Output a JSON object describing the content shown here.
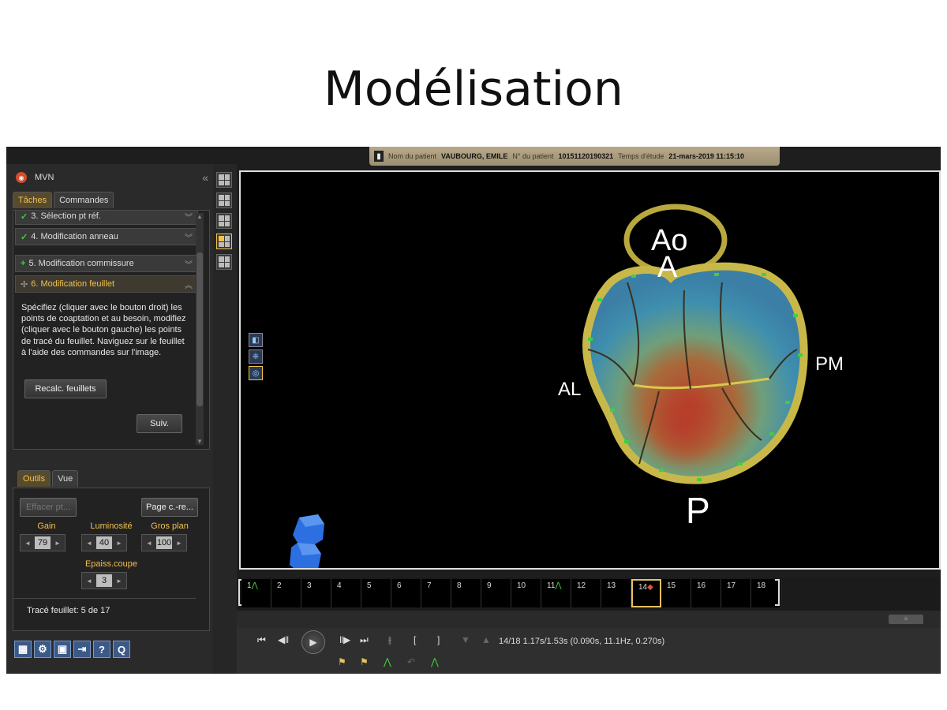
{
  "slide": {
    "title": "Modélisation"
  },
  "patient": {
    "name_label": "Nom du patient",
    "name_value": "VAUBOURG, EMILE",
    "id_label": "N° du patient",
    "id_value": "10151120190321",
    "study_label": "Temps d'étude",
    "study_value": "21-mars-2019 11:15:10"
  },
  "panel": {
    "title": "MVN",
    "collapse_icon": "«",
    "tabs": [
      "Tâches",
      "Commandes"
    ],
    "tasks": [
      {
        "label": "3. Sélection pt réf.",
        "status": "done"
      },
      {
        "label": "4. Modification anneau",
        "status": "done"
      },
      {
        "label": "5. Modification commissure",
        "status": "plus"
      },
      {
        "label": "6. Modification feuillet",
        "status": "current"
      }
    ],
    "description": "Spécifiez (cliquer avec le bouton droit) les points de coaptation et au besoin, modifiez (cliquer avec le bouton gauche) les points de tracé du feuillet. Naviguez sur le feuillet à l'aide des commandes sur l'image.",
    "recalc_button": "Recalc. feuillets",
    "next_button": "Suiv."
  },
  "tools": {
    "tabs": [
      "Outils",
      "Vue"
    ],
    "erase_button": "Effacer pt...",
    "page_button": "Page c.-re...",
    "gain_label": "Gain",
    "gain_value": "79",
    "brightness_label": "Luminosité",
    "brightness_value": "40",
    "zoom_label": "Gros plan",
    "zoom_value": "100",
    "thickness_label": "Epaiss.coupe",
    "thickness_value": "3",
    "trace_status": "Tracé feuillet: 5 de 17"
  },
  "viewer": {
    "labels": {
      "ao": "Ao",
      "a": "A",
      "pm": "PM",
      "al": "AL",
      "p": "P"
    }
  },
  "timeline": {
    "frames": [
      "1",
      "2",
      "3",
      "4",
      "5",
      "6",
      "7",
      "8",
      "9",
      "10",
      "11",
      "12",
      "13",
      "14",
      "15",
      "16",
      "17",
      "18"
    ],
    "ecg_frames": [
      1,
      11
    ],
    "selected_frame": 14,
    "status": "14/18  1.17s/1.53s (0.090s, 11.1Hz, 0.270s)"
  },
  "colors": {
    "accent": "#f2c14e",
    "annulus": "#c8b84a",
    "ecg": "#3fcf3f"
  }
}
